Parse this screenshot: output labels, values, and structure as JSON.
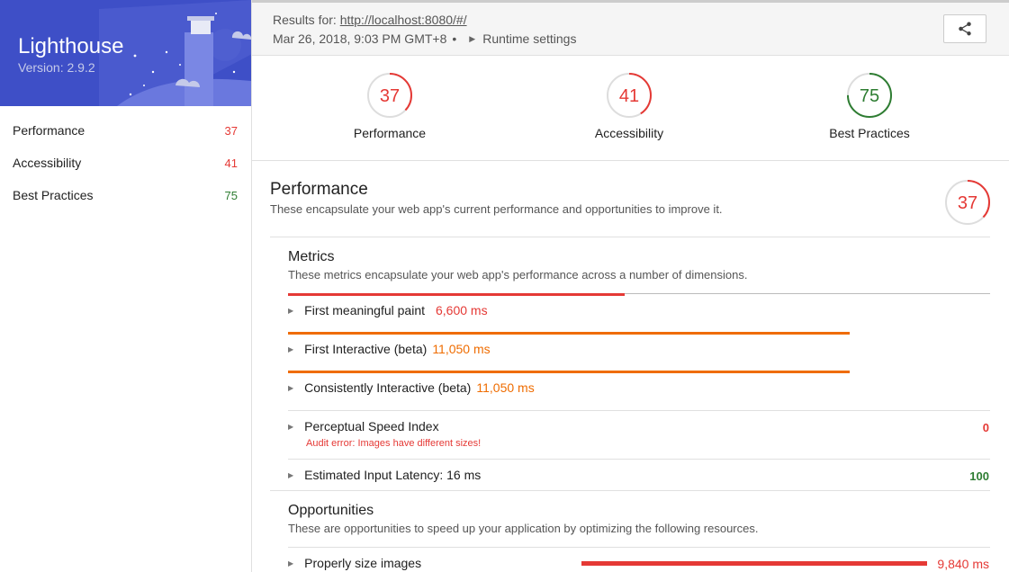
{
  "brand": {
    "title": "Lighthouse",
    "version": "Version: 2.9.2"
  },
  "nav": [
    {
      "label": "Performance",
      "score": "37"
    },
    {
      "label": "Accessibility",
      "score": "41"
    },
    {
      "label": "Best Practices",
      "score": "75"
    }
  ],
  "topbar": {
    "results_prefix": "Results for:",
    "url": "http://localhost:8080/#/",
    "date": "Mar 26, 2018, 9:03 PM GMT+8",
    "bullet": "•",
    "runtime_label": "Runtime settings"
  },
  "gauges": [
    {
      "score": "37",
      "label": "Performance",
      "value": 37,
      "color": "#e53935"
    },
    {
      "score": "41",
      "label": "Accessibility",
      "value": 41,
      "color": "#e53935"
    },
    {
      "score": "75",
      "label": "Best Practices",
      "value": 75,
      "color": "#2e7d32"
    }
  ],
  "performance": {
    "title": "Performance",
    "description": "These encapsulate your web app's current performance and opportunities to improve it.",
    "score": "37",
    "score_value": 37,
    "metrics": {
      "title": "Metrics",
      "description": "These metrics encapsulate your web app's performance across a number of dimensions.",
      "items": [
        {
          "label": "First meaningful paint",
          "value": "6,600 ms",
          "bar_fraction": 0.48,
          "color": "#e53935"
        },
        {
          "label": "First Interactive (beta)",
          "value": "11,050 ms",
          "bar_fraction": 0.8,
          "color": "#ef6c00"
        },
        {
          "label": "Consistently Interactive (beta)",
          "value": "11,050 ms",
          "bar_fraction": 0.8,
          "color": "#ef6c00"
        }
      ],
      "psi": {
        "label": "Perceptual Speed Index",
        "score": "0",
        "error": "Audit error: Images have different sizes!"
      },
      "latency": {
        "label": "Estimated Input Latency: 16 ms",
        "score": "100"
      }
    },
    "opportunities": {
      "title": "Opportunities",
      "description": "These are opportunities to speed up your application by optimizing the following resources.",
      "items": [
        {
          "label": "Properly size images",
          "value": "9,840 ms"
        }
      ]
    }
  },
  "colors": {
    "brand": "#3e4fc7",
    "fail": "#e53935",
    "average": "#ef6c00",
    "pass": "#2e7d32"
  },
  "icons": {
    "share": "share-icon",
    "expand": "triangle-right-icon",
    "lighthouse": "lighthouse-illustration"
  }
}
